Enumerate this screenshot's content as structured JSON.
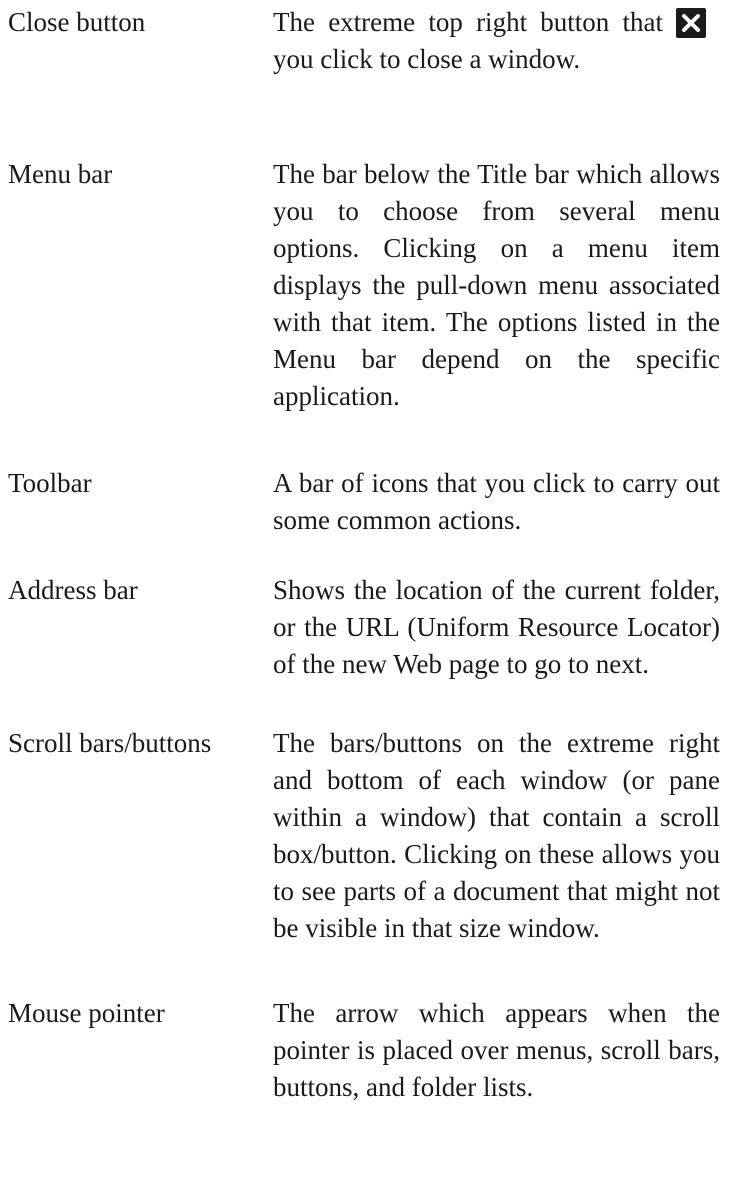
{
  "glossary": [
    {
      "term": "Close button",
      "definition": "The extreme top right button that you click to close a window."
    },
    {
      "term": "Menu bar",
      "definition": "The bar below the Title bar which allows you to choose from several menu options. Clicking on a menu item displays the pull-down menu associated with that item. The options listed in the Menu bar depend on the specific application."
    },
    {
      "term": "Toolbar",
      "definition": "A bar of icons that you click to carry out some common actions."
    },
    {
      "term": "Address bar",
      "definition": "Shows the location of the current folder, or the URL (Uniform Resource Locator) of the new Web page to go to next."
    },
    {
      "term": "Scroll bars/buttons",
      "definition": "The bars/buttons on the extreme right and bottom of each window (or pane within a window) that contain a scroll box/button. Clicking on these allows you to see parts of a document that might not be visible in that size window."
    },
    {
      "term": "Mouse pointer",
      "definition": "The arrow which appears when the pointer is placed over menus, scroll bars, buttons, and folder lists."
    }
  ],
  "icons": {
    "close": "close-icon"
  }
}
